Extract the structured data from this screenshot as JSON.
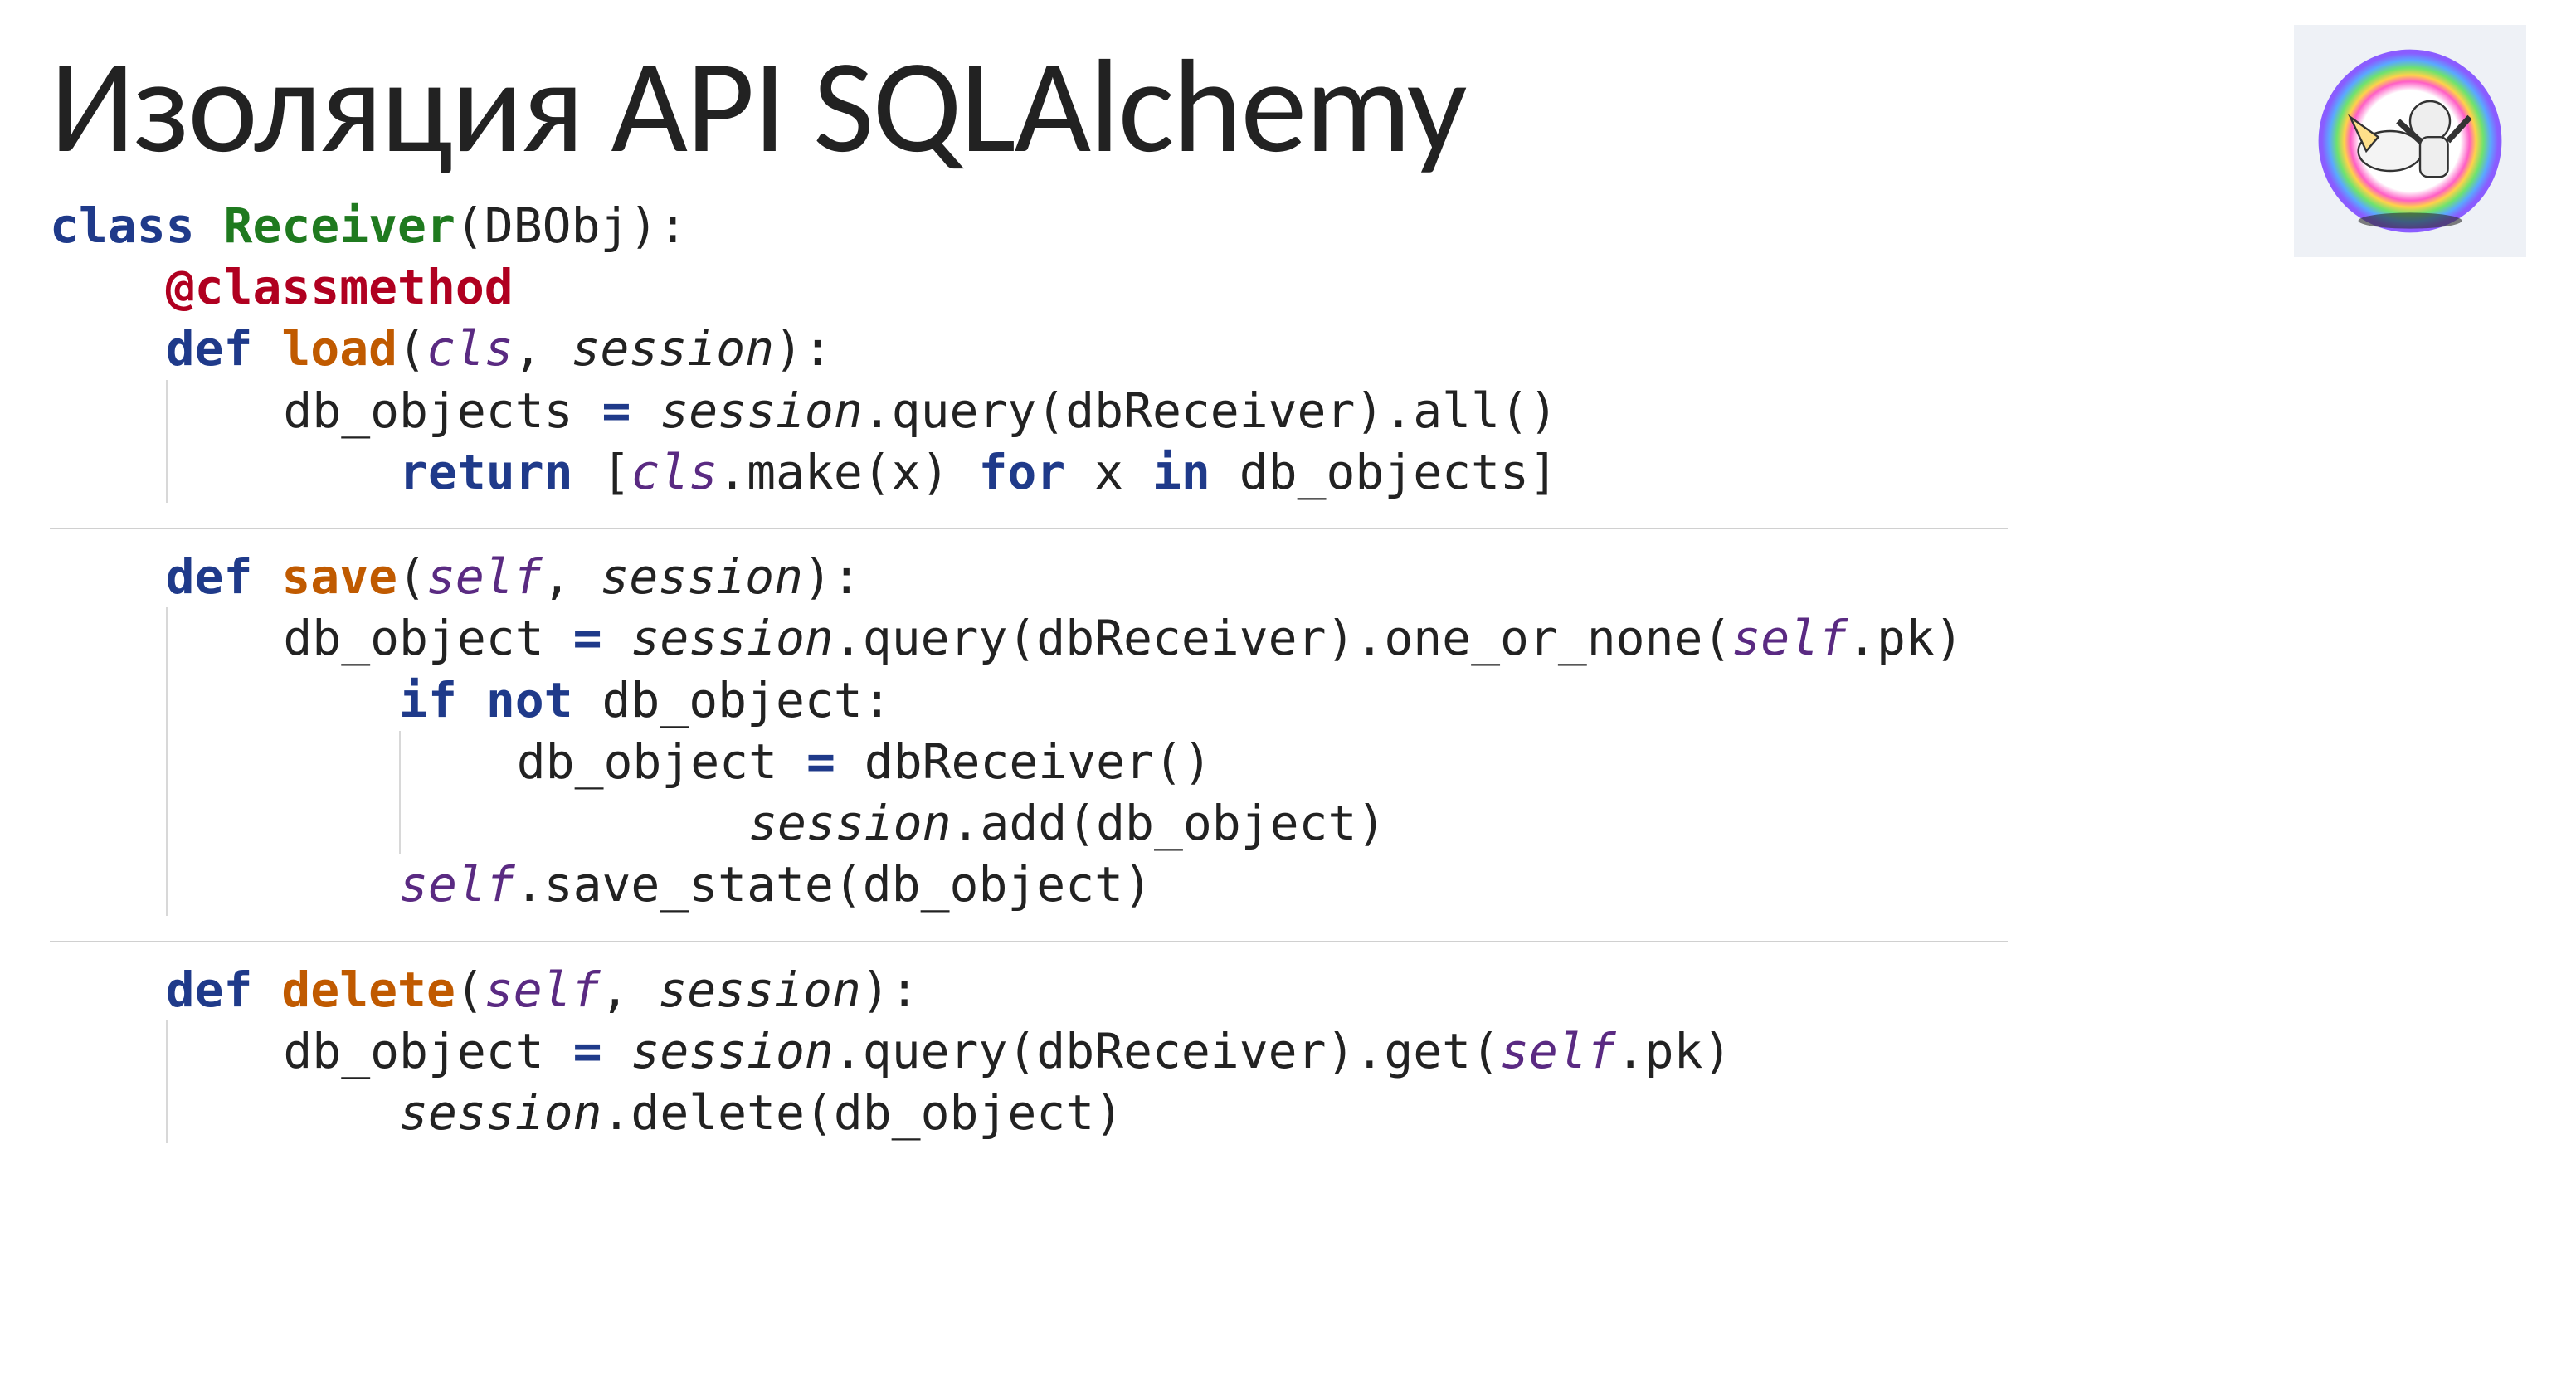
{
  "title": "Изоляция API SQLAlchemy",
  "logo_name": "unicorn-astronaut-logo",
  "code": {
    "class_kw": "class",
    "class_name": "Receiver",
    "class_base": "(DBObj):",
    "decorator": "@classmethod",
    "def_kw": "def",
    "fn_load": "load",
    "fn_save": "save",
    "fn_delete": "delete",
    "param_cls": "cls",
    "param_self": "self",
    "param_session": "session",
    "sig_close": "):",
    "load_body1_a": "db_objects ",
    "load_body1_eq": "=",
    "load_body1_b": " session",
    "load_body1_c": ".query(dbReceiver).all()",
    "return_kw": "return",
    "load_ret_a": " [",
    "load_ret_cls": "cls",
    "load_ret_b": ".make(x) ",
    "for_kw": "for",
    "load_ret_c": " x ",
    "in_kw": "in",
    "load_ret_d": " db_objects]",
    "save_body1_a": "db_object ",
    "save_body1_eq": "=",
    "save_body1_b": " session",
    "save_body1_c": ".query(dbReceiver).one_or_none(",
    "save_body1_self": "self",
    "save_body1_d": ".pk)",
    "if_kw": "if",
    "not_kw": "not",
    "save_if_tail": " db_object:",
    "save_body2_a": "db_object ",
    "save_body2_eq": "=",
    "save_body2_b": " dbReceiver()",
    "save_body3_a": "session",
    "save_body3_b": ".add(db_object)",
    "save_body4_self": "self",
    "save_body4_b": ".save_state(db_object)",
    "del_body1_a": "db_object ",
    "del_body1_eq": "=",
    "del_body1_b": " session",
    "del_body1_c": ".query(dbReceiver).get(",
    "del_body1_self": "self",
    "del_body1_d": ".pk)",
    "del_body2_a": "session",
    "del_body2_b": ".delete(db_object)"
  }
}
